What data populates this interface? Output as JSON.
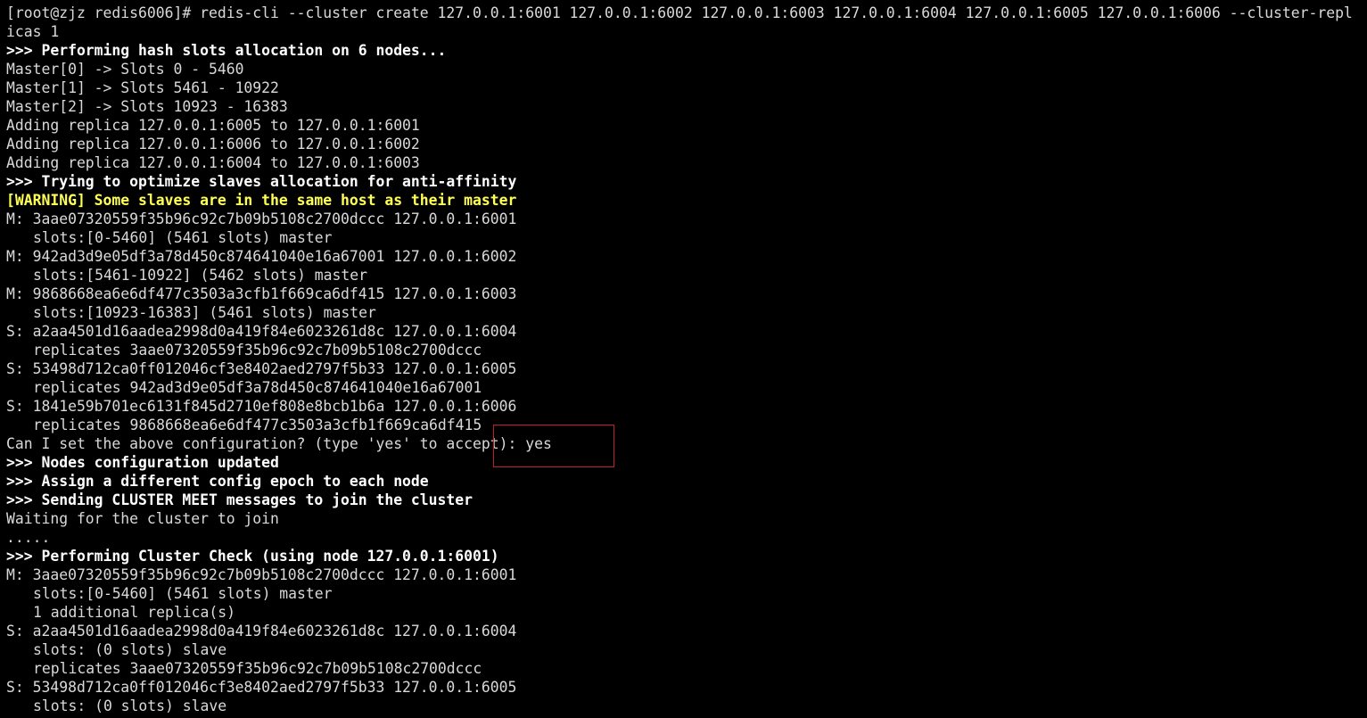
{
  "terminal": {
    "colors": {
      "background": "#000000",
      "text": "#d9d9d9",
      "header": "#ffffff",
      "warning": "#ffff54",
      "highlight_box": "#c0202a"
    },
    "lines": [
      {
        "text": "[root@zjz redis6006]# redis-cli --cluster create 127.0.0.1:6001 127.0.0.1:6002 127.0.0.1:6003 127.0.0.1:6004 127.0.0.1:6005 127.0.0.1:6006 --cluster-repl"
      },
      {
        "text": "icas 1"
      },
      {
        "text": ">>> Performing hash slots allocation on 6 nodes..."
      },
      {
        "text": "Master[0] -> Slots 0 - 5460"
      },
      {
        "text": "Master[1] -> Slots 5461 - 10922"
      },
      {
        "text": "Master[2] -> Slots 10923 - 16383"
      },
      {
        "text": "Adding replica 127.0.0.1:6005 to 127.0.0.1:6001"
      },
      {
        "text": "Adding replica 127.0.0.1:6006 to 127.0.0.1:6002"
      },
      {
        "text": "Adding replica 127.0.0.1:6004 to 127.0.0.1:6003"
      },
      {
        "text": ">>> Trying to optimize slaves allocation for anti-affinity"
      },
      {
        "text": "[WARNING] Some slaves are in the same host as their master"
      },
      {
        "text": "M: 3aae07320559f35b96c92c7b09b5108c2700dccc 127.0.0.1:6001"
      },
      {
        "text": "slots:[0-5460] (5461 slots) master"
      },
      {
        "text": "M: 942ad3d9e05df3a78d450c874641040e16a67001 127.0.0.1:6002"
      },
      {
        "text": "slots:[5461-10922] (5462 slots) master"
      },
      {
        "text": "M: 9868668ea6e6df477c3503a3cfb1f669ca6df415 127.0.0.1:6003"
      },
      {
        "text": "slots:[10923-16383] (5461 slots) master"
      },
      {
        "text": "S: a2aa4501d16aadea2998d0a419f84e6023261d8c 127.0.0.1:6004"
      },
      {
        "text": "replicates 3aae07320559f35b96c92c7b09b5108c2700dccc"
      },
      {
        "text": "S: 53498d712ca0ff012046cf3e8402aed2797f5b33 127.0.0.1:6005"
      },
      {
        "text": "replicates 942ad3d9e05df3a78d450c874641040e16a67001"
      },
      {
        "text": "S: 1841e59b701ec6131f845d2710ef808e8bcb1b6a 127.0.0.1:6006"
      },
      {
        "text": "replicates 9868668ea6e6df477c3503a3cfb1f669ca6df415"
      },
      {
        "text": "Can I set the above configuration? (type 'yes' to accept): yes"
      },
      {
        "text": ">>> Nodes configuration updated"
      },
      {
        "text": ">>> Assign a different config epoch to each node"
      },
      {
        "text": ">>> Sending CLUSTER MEET messages to join the cluster"
      },
      {
        "text": "Waiting for the cluster to join"
      },
      {
        "text": "....."
      },
      {
        "text": ">>> Performing Cluster Check (using node 127.0.0.1:6001)"
      },
      {
        "text": "M: 3aae07320559f35b96c92c7b09b5108c2700dccc 127.0.0.1:6001"
      },
      {
        "text": "slots:[0-5460] (5461 slots) master"
      },
      {
        "text": "1 additional replica(s)"
      },
      {
        "text": "S: a2aa4501d16aadea2998d0a419f84e6023261d8c 127.0.0.1:6004"
      },
      {
        "text": "slots: (0 slots) slave"
      },
      {
        "text": "replicates 3aae07320559f35b96c92c7b09b5108c2700dccc"
      },
      {
        "text": "S: 53498d712ca0ff012046cf3e8402aed2797f5b33 127.0.0.1:6005"
      },
      {
        "text": "slots: (0 slots) slave"
      }
    ]
  }
}
